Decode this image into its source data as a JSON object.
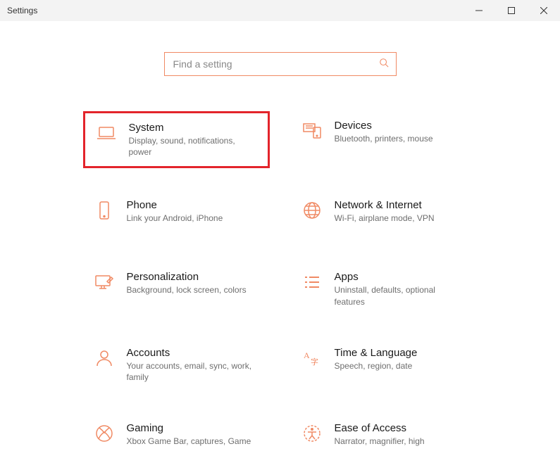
{
  "window": {
    "title": "Settings"
  },
  "search": {
    "placeholder": "Find a setting"
  },
  "tiles": {
    "system": {
      "title": "System",
      "sub": "Display, sound, notifications, power"
    },
    "devices": {
      "title": "Devices",
      "sub": "Bluetooth, printers, mouse"
    },
    "phone": {
      "title": "Phone",
      "sub": "Link your Android, iPhone"
    },
    "network": {
      "title": "Network & Internet",
      "sub": "Wi-Fi, airplane mode, VPN"
    },
    "personalization": {
      "title": "Personalization",
      "sub": "Background, lock screen, colors"
    },
    "apps": {
      "title": "Apps",
      "sub": "Uninstall, defaults, optional features"
    },
    "accounts": {
      "title": "Accounts",
      "sub": "Your accounts, email, sync, work, family"
    },
    "time": {
      "title": "Time & Language",
      "sub": "Speech, region, date"
    },
    "gaming": {
      "title": "Gaming",
      "sub": "Xbox Game Bar, captures, Game"
    },
    "ease": {
      "title": "Ease of Access",
      "sub": "Narrator, magnifier, high"
    }
  }
}
